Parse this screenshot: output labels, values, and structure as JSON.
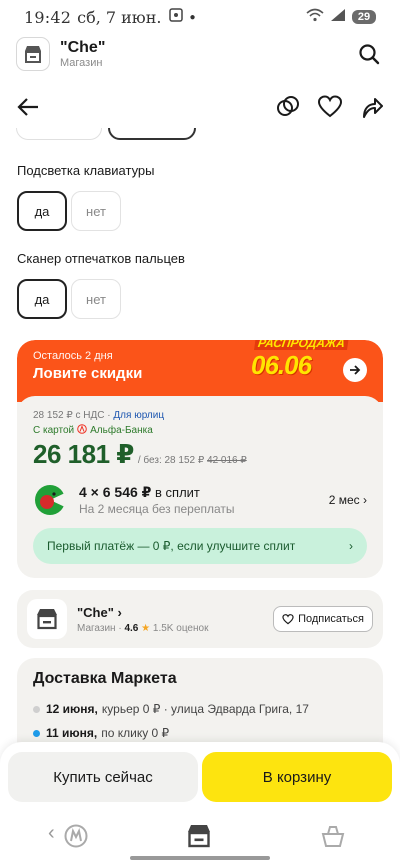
{
  "status_bar": {
    "time": "19:42",
    "date": "сб, 7 июн.",
    "battery": "29"
  },
  "shop": {
    "name": "\"Che\"",
    "subtitle": "Магазин"
  },
  "options": [
    {
      "title": "Подсветка клавиатуры",
      "choices": [
        "да",
        "нет"
      ],
      "selected": "да"
    },
    {
      "title": "Сканер отпечатков пальцев",
      "choices": [
        "да",
        "нет"
      ],
      "selected": "да"
    }
  ],
  "promo": {
    "subtitle": "Осталось 2 дня",
    "title": "Ловите скидки",
    "art_top": "РАСПРОДАЖА",
    "art_date": "06.06",
    "color": "#fb5419"
  },
  "price": {
    "vat": "28 152 ₽ с НДС",
    "legal": "Для юрлиц",
    "card_label": "С картой",
    "bank": "Альфа-Банка",
    "main": "26 181 ₽",
    "without_label": "/ без: 28 152 ₽",
    "old": "42 016 ₽"
  },
  "split": {
    "amount": "4 × 6 546 ₽",
    "suffix": "в сплит",
    "subtitle": "На 2 месяца без переплаты",
    "period": "2 мес ›",
    "banner": "Первый платёж — 0 ₽, если улучшите сплит",
    "banner_chevron": "›"
  },
  "seller": {
    "name": "\"Che\" ›",
    "type": "Магазин ·",
    "rating": "4.6",
    "star": "★",
    "reviews": "1.5K оценок",
    "subscribe": "Подписаться"
  },
  "delivery": {
    "title": "Доставка Маркета",
    "items": [
      {
        "date": "12 июня,",
        "text": "курьер 0 ₽ · улица Эдварда Грига, 17",
        "dot_color": "#cfcfcf"
      },
      {
        "date": "11 июня,",
        "text": "по клику 0 ₽",
        "dot_color": "#1e9be9"
      }
    ]
  },
  "actions": {
    "buy_now": "Купить сейчас",
    "to_cart": "В корзину",
    "accent": "#fde40f"
  },
  "nav": {
    "back": "‹"
  }
}
